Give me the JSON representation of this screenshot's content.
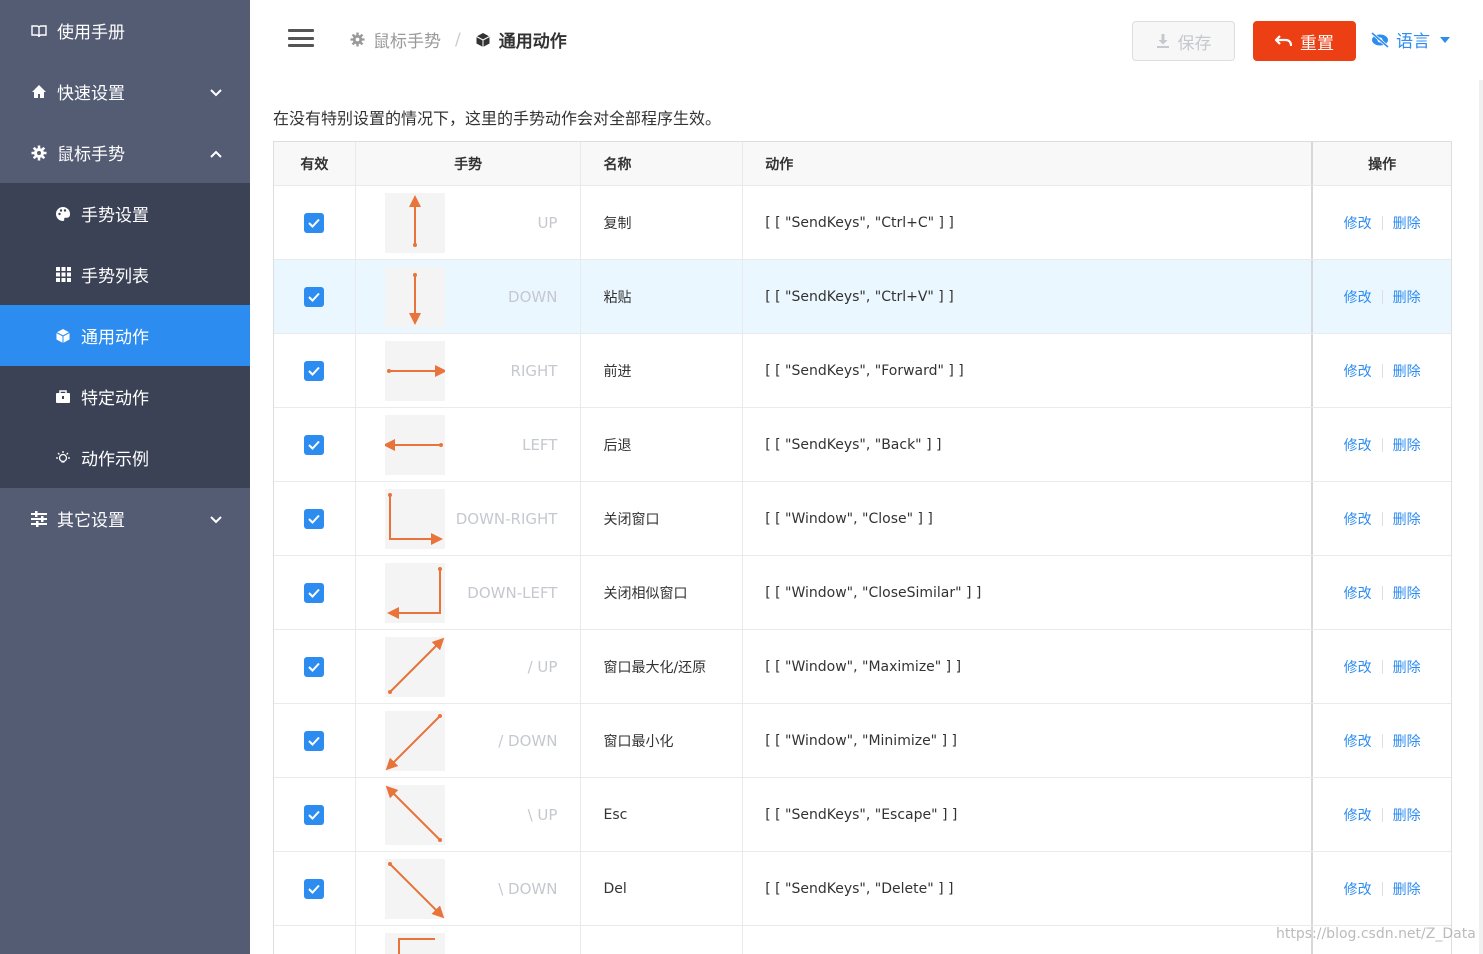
{
  "sidebar": {
    "manual": "使用手册",
    "quick": "快速设置",
    "mouse": "鼠标手势",
    "sub": [
      "手势设置",
      "手势列表",
      "通用动作",
      "特定动作",
      "动作示例"
    ],
    "other": "其它设置"
  },
  "header": {
    "crumb1": "鼠标手势",
    "crumb2": "通用动作",
    "save": "保存",
    "reset": "重置",
    "lang": "语言"
  },
  "content": {
    "description": "在没有特别设置的情况下，这里的手势动作会对全部程序生效。",
    "columns": [
      "有效",
      "手势",
      "名称",
      "动作",
      "操作"
    ],
    "edit": "修改",
    "delete": "删除",
    "rows": [
      {
        "gesture": "UP",
        "name": "复制",
        "action": "[ [ \"SendKeys\", \"Ctrl+C\" ] ]",
        "icon": "arrow-up"
      },
      {
        "gesture": "DOWN",
        "name": "粘贴",
        "action": "[ [ \"SendKeys\", \"Ctrl+V\" ] ]",
        "icon": "arrow-down"
      },
      {
        "gesture": "RIGHT",
        "name": "前进",
        "action": "[ [ \"SendKeys\", \"Forward\" ] ]",
        "icon": "arrow-right"
      },
      {
        "gesture": "LEFT",
        "name": "后退",
        "action": "[ [ \"SendKeys\", \"Back\" ] ]",
        "icon": "arrow-left"
      },
      {
        "gesture": "DOWN-RIGHT",
        "name": "关闭窗口",
        "action": "[ [ \"Window\", \"Close\" ] ]",
        "icon": "arrow-down-right"
      },
      {
        "gesture": "DOWN-LEFT",
        "name": "关闭相似窗口",
        "action": "[ [ \"Window\", \"CloseSimilar\" ] ]",
        "icon": "arrow-down-left"
      },
      {
        "gesture": "/ UP",
        "name": "窗口最大化/还原",
        "action": "[ [ \"Window\", \"Maximize\" ] ]",
        "icon": "arrow-diag-up"
      },
      {
        "gesture": "/ DOWN",
        "name": "窗口最小化",
        "action": "[ [ \"Window\", \"Minimize\" ] ]",
        "icon": "arrow-diag-down"
      },
      {
        "gesture": "\\ UP",
        "name": "Esc",
        "action": "[ [ \"SendKeys\", \"Escape\" ] ]",
        "icon": "arrow-bdiag-up"
      },
      {
        "gesture": "\\ DOWN",
        "name": "Del",
        "action": "[ [ \"SendKeys\", \"Delete\" ] ]",
        "icon": "arrow-bdiag-down"
      }
    ]
  },
  "watermark": "https://blog.csdn.net/Z_Data",
  "colors": {
    "accent": "#2d8cf0",
    "danger": "#ed3f14",
    "stroke": "#e8743b",
    "sidebar": "#545c74"
  }
}
